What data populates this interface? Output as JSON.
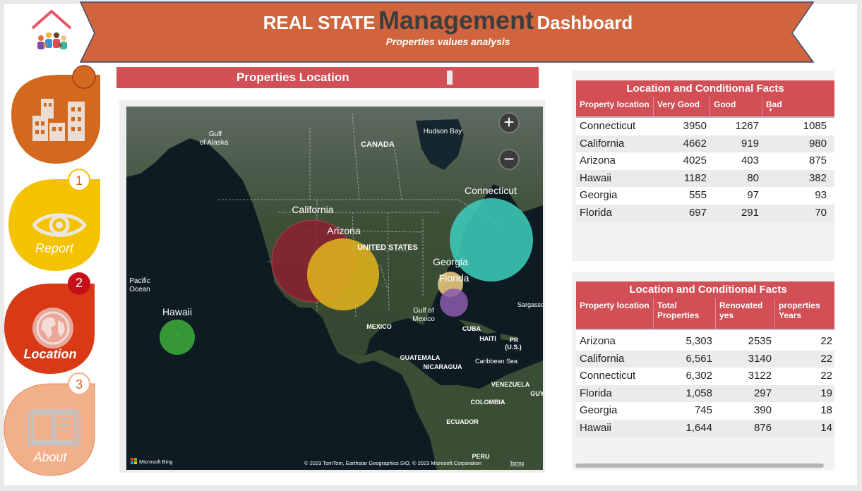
{
  "header": {
    "title_part1": "REAL STATE",
    "title_part2": "Management",
    "title_part3": "Dashboard",
    "subtitle": "Properties values analysis"
  },
  "nav": {
    "items": [
      {
        "label": "",
        "badge": "",
        "icon": "buildings-icon"
      },
      {
        "label": "Report",
        "badge": "1",
        "icon": "eye-icon"
      },
      {
        "label": "Location",
        "badge": "2",
        "icon": "globe-icon"
      },
      {
        "label": "About",
        "badge": "3",
        "icon": "book-icon"
      }
    ]
  },
  "map_section": {
    "title": "Properties Location",
    "zoom_in": "+",
    "zoom_out": "−",
    "attribution_logo": "Microsoft Bing",
    "attribution": "© 2023 TomTom, Earthstar Geographics SIO, © 2023 Microsoft Corporation",
    "terms": "Terms",
    "geo_labels": [
      "Gulf of Alaska",
      "CANADA",
      "Hudson Bay",
      "UNITED STATES",
      "Pacific Ocean",
      "Gulf of Mexico",
      "MEXICO",
      "CUBA",
      "HAITI",
      "PR (U.S.)",
      "Caribbean Sea",
      "GUATEMALA",
      "NICARAGUA",
      "VENEZUELA",
      "COLOMBIA",
      "ECUADOR",
      "PERU",
      "Sargasso",
      "GUY"
    ],
    "bubbles": [
      {
        "label": "California",
        "color": "#8b2030"
      },
      {
        "label": "Arizona",
        "color": "#e0b21c"
      },
      {
        "label": "Connecticut",
        "color": "#3dd0bd"
      },
      {
        "label": "Georgia",
        "color": "#f2cf83"
      },
      {
        "label": "Florida",
        "color": "#8a5cae"
      },
      {
        "label": "Hawaii",
        "color": "#3aa637"
      }
    ]
  },
  "table1": {
    "title": "Location and Conditional Facts",
    "headers": [
      "Property location",
      "Very Good",
      "Good",
      "Bad"
    ],
    "rows": [
      [
        "Connecticut",
        "3950",
        "1267",
        "1085"
      ],
      [
        "California",
        "4662",
        "919",
        "980"
      ],
      [
        "Arizona",
        "4025",
        "403",
        "875"
      ],
      [
        "Hawaii",
        "1182",
        "80",
        "382"
      ],
      [
        "Georgia",
        "555",
        "97",
        "93"
      ],
      [
        "Florida",
        "697",
        "291",
        "70"
      ]
    ]
  },
  "table2": {
    "title": "Location and Conditional Facts",
    "headers": [
      "Property location",
      "Total Properties",
      "Renovated yes",
      "properties Years"
    ],
    "rows": [
      [
        "Arizona",
        "5,303",
        "2535",
        "22"
      ],
      [
        "California",
        "6,561",
        "3140",
        "22"
      ],
      [
        "Connecticut",
        "6,302",
        "3122",
        "22"
      ],
      [
        "Florida",
        "1,058",
        "297",
        "19"
      ],
      [
        "Georgia",
        "745",
        "390",
        "18"
      ],
      [
        "Hawaii",
        "1,644",
        "876",
        "14"
      ]
    ]
  },
  "colors": {
    "banner": "#d0643d",
    "accent_red": "#d14f55",
    "nav_buildings": "#d2691e",
    "nav_report": "#f5c200",
    "nav_location": "#d93a16",
    "nav_about": "#f2b08a"
  }
}
